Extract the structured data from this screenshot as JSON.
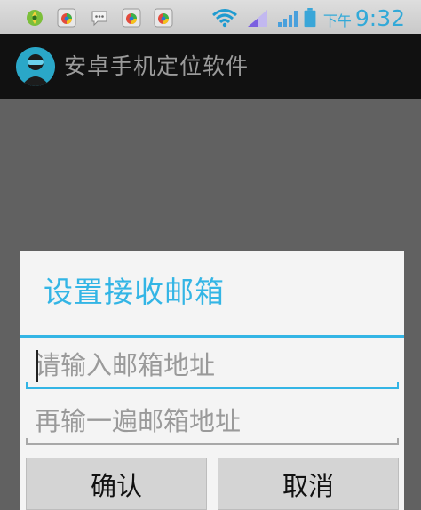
{
  "status_bar": {
    "icons": [
      "sync-icon",
      "app-icon",
      "message-icon",
      "app-icon",
      "app-icon",
      "wifi-icon",
      "signal-icon",
      "signal-icon",
      "battery-icon"
    ],
    "period": "下午",
    "time": "9:32",
    "accent_color": "#32a9d8"
  },
  "action_bar": {
    "title": "安卓手机定位软件",
    "background": "#111111"
  },
  "dialog": {
    "title": "设置接收邮箱",
    "accent_color": "#33b5e5",
    "email_field": {
      "value": "",
      "placeholder": "请输入邮箱地址"
    },
    "confirm_email_field": {
      "value": "",
      "placeholder": "再输一遍邮箱地址"
    },
    "confirm_label": "确认",
    "cancel_label": "取消"
  }
}
